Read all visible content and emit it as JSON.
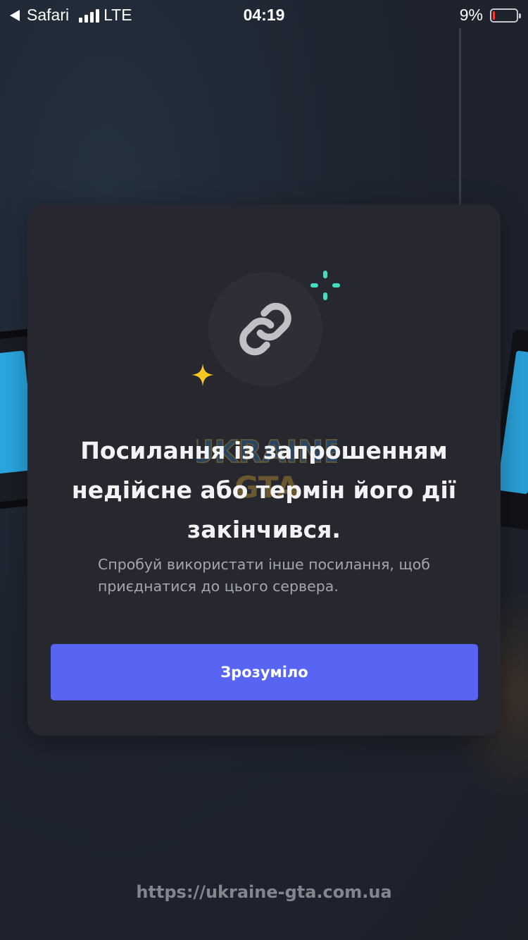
{
  "status_bar": {
    "app": "Safari",
    "network": "LTE",
    "time": "04:19",
    "battery_percent_text": "9%",
    "battery_level": 0.09,
    "signal_bars": 4
  },
  "modal": {
    "title": "Посилання із запрошенням недійсне або термін його дії закінчився.",
    "subtitle": "Спробуй використати інше посилання, щоб приєднатися до цього сервера.",
    "button_label": "Зрозуміло",
    "icon": "link-icon"
  },
  "watermark": {
    "url": "https://ukraine-gta.com.ua",
    "logo_text": "UKRAINE GTA"
  },
  "colors": {
    "modal_bg": "#27272f",
    "button": "#5865f2",
    "accent_teal": "#45ddc0",
    "accent_yellow": "#f9c624",
    "battery_low": "#ff3b30"
  }
}
